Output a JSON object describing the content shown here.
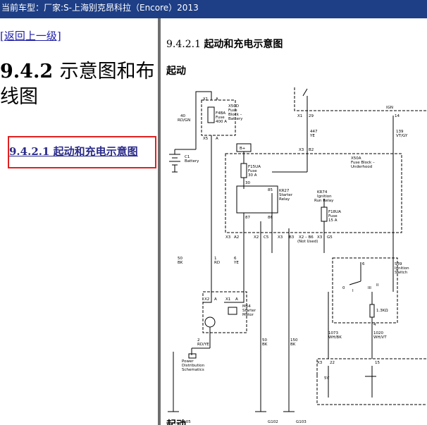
{
  "header": {
    "vehicle_label": "当前车型：厂家:S-上海别克昂科拉（Encore）2013"
  },
  "left_pane": {
    "back_link": "[返回上一级]",
    "section_title_num": "9.4.2",
    "section_title_text": "示意图和布线图",
    "toc_item": "9.4.2.1 起动和充电示意图"
  },
  "right_pane": {
    "heading_num": "9.4.2.1",
    "heading_text": "起动和充电示意图",
    "subheading": "起动",
    "subheading_bottom": "起动"
  },
  "schematic": {
    "labels": {
      "x1_left": "X1",
      "x1_a": "A",
      "x50d": "X50D",
      "x50d_desc1": "Fuse",
      "x50d_desc2": "Block –",
      "x50d_desc3": "Battery",
      "f4ba": "F4BA",
      "f4ba_fuse": "Fuse",
      "f4ba_amp": "400 A",
      "x5": "X5",
      "x5_a": "A",
      "wire40": "40",
      "wire40_color": "RD/GN",
      "c1": "C1",
      "c1_desc": "Battery",
      "x1_right": "X1",
      "pin29": "29",
      "ign": "IGN",
      "pin14": "14",
      "wire447": "447",
      "wire447_color": "YE",
      "wire139": "139",
      "wire139_color": "VT/GY",
      "x3_top": "X3",
      "b2": "B2",
      "bplus": "B+",
      "x50a": "X50A",
      "x50a_d1": "Fuse Block –",
      "x50a_d2": "Underhood",
      "f15ua": "F15UA",
      "f15ua_fuse": "Fuse",
      "f15ua_amp": "30 A",
      "pin30": "30",
      "pin85": "85",
      "kr27": "KR27",
      "kr27_d1": "Starter",
      "kr27_d2": "Relay",
      "pin87": "87",
      "pin86": "86",
      "kr74": "KR74",
      "kr74_d1": "Ignition",
      "kr74_d2": "Run Relay",
      "f18ua": "F18UA",
      "f18ua_fuse": "Fuse",
      "f18ua_amp": "15 A",
      "x3_a2a": "X3",
      "a2": "A2",
      "x2_c5": "X2",
      "c5": "C5",
      "x3_b3": "X3",
      "b3": "B3",
      "x2_b6": "X2 – B6",
      "not_used": "(Not Used)",
      "x3_g5": "X3",
      "g5": "G5",
      "wire50": "50",
      "wire50_color": "BK",
      "wire1": "1",
      "wire1_color": "RD",
      "wire6": "6",
      "wire6_color": "YE",
      "s39": "S39",
      "s39_d1": "Ignition",
      "s39_d2": "Switch",
      "pin6": "6",
      "sw_II": "II",
      "sw_III": "III",
      "sw_0": "0",
      "sw_I": "I",
      "res": "1.3KΩ",
      "pin4": "4",
      "x2_m": "X2",
      "m_a": "A",
      "x1_m": "X1",
      "m_a2": "A",
      "m64": "M64",
      "m64_d1": "Starter",
      "m64_d2": "Motor",
      "wire2": "2",
      "wire2_color": "RD/YE",
      "pwr1": "Power",
      "pwr2": "Distribution",
      "pwr3": "Schematics",
      "wire50b": "50",
      "wire50b_color": "BK",
      "wire150": "150",
      "wire150_color": "BK",
      "wire1073": "1073",
      "wire1073_color": "WH/BK",
      "wire1020": "1020",
      "wire1020_color": "WH/VT",
      "x3_bot": "X3",
      "pin22": "22",
      "pin15": "15",
      "v5": "5V",
      "g105": "G105",
      "g102": "G102",
      "g103": "G103"
    }
  }
}
